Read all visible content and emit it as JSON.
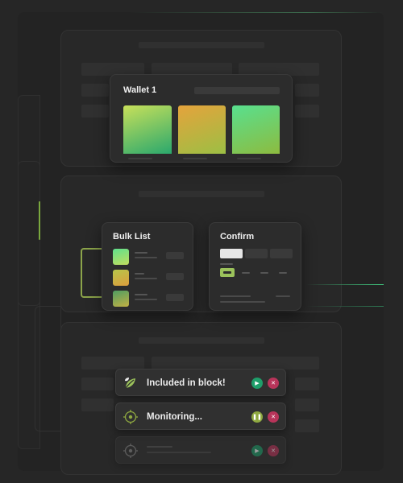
{
  "wallet": {
    "title": "Wallet 1"
  },
  "bulk_list": {
    "title": "Bulk List"
  },
  "confirm": {
    "title": "Confirm"
  },
  "status": [
    {
      "label": "Included in block!",
      "icon": "leaf-icon"
    },
    {
      "label": "Monitoring...",
      "icon": "target-icon"
    },
    {
      "label": "",
      "icon": "target-icon"
    }
  ],
  "colors": {
    "accent_green": "#1e9e6a",
    "accent_lime": "#9bc25b",
    "accent_red": "#b8345a",
    "background": "#262626"
  }
}
